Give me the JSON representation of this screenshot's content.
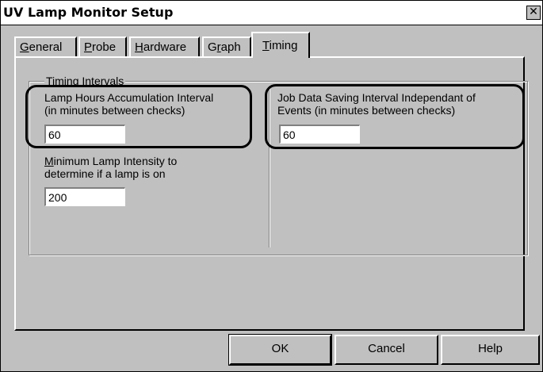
{
  "window": {
    "title": "UV Lamp Monitor Setup",
    "close_glyph": "✕"
  },
  "tabs": [
    {
      "mnemonic": "G",
      "rest": "eneral"
    },
    {
      "mnemonic": "P",
      "rest": "robe"
    },
    {
      "mnemonic": "H",
      "rest": "ardware"
    },
    {
      "pre": "G",
      "mnemonic": "r",
      "rest": "aph"
    },
    {
      "mnemonic": "T",
      "rest": "iming",
      "active": true
    }
  ],
  "group": {
    "label": "Timing Intervals"
  },
  "fields": {
    "lamp_hours": {
      "label_line1": "Lamp Hours Accumulation Interval",
      "label_line2": "(in minutes between checks)",
      "value": "60"
    },
    "job_data": {
      "label_line1": "Job Data Saving Interval Independant of",
      "label_line2": "Events (in minutes between checks)",
      "value": "60"
    },
    "min_intensity": {
      "label_mnemonic": "M",
      "label_line1_rest": "inimum Lamp Intensity to",
      "label_line2": "determine if a lamp is on",
      "value": "200"
    }
  },
  "buttons": {
    "ok": "OK",
    "cancel": "Cancel",
    "help": "Help"
  }
}
